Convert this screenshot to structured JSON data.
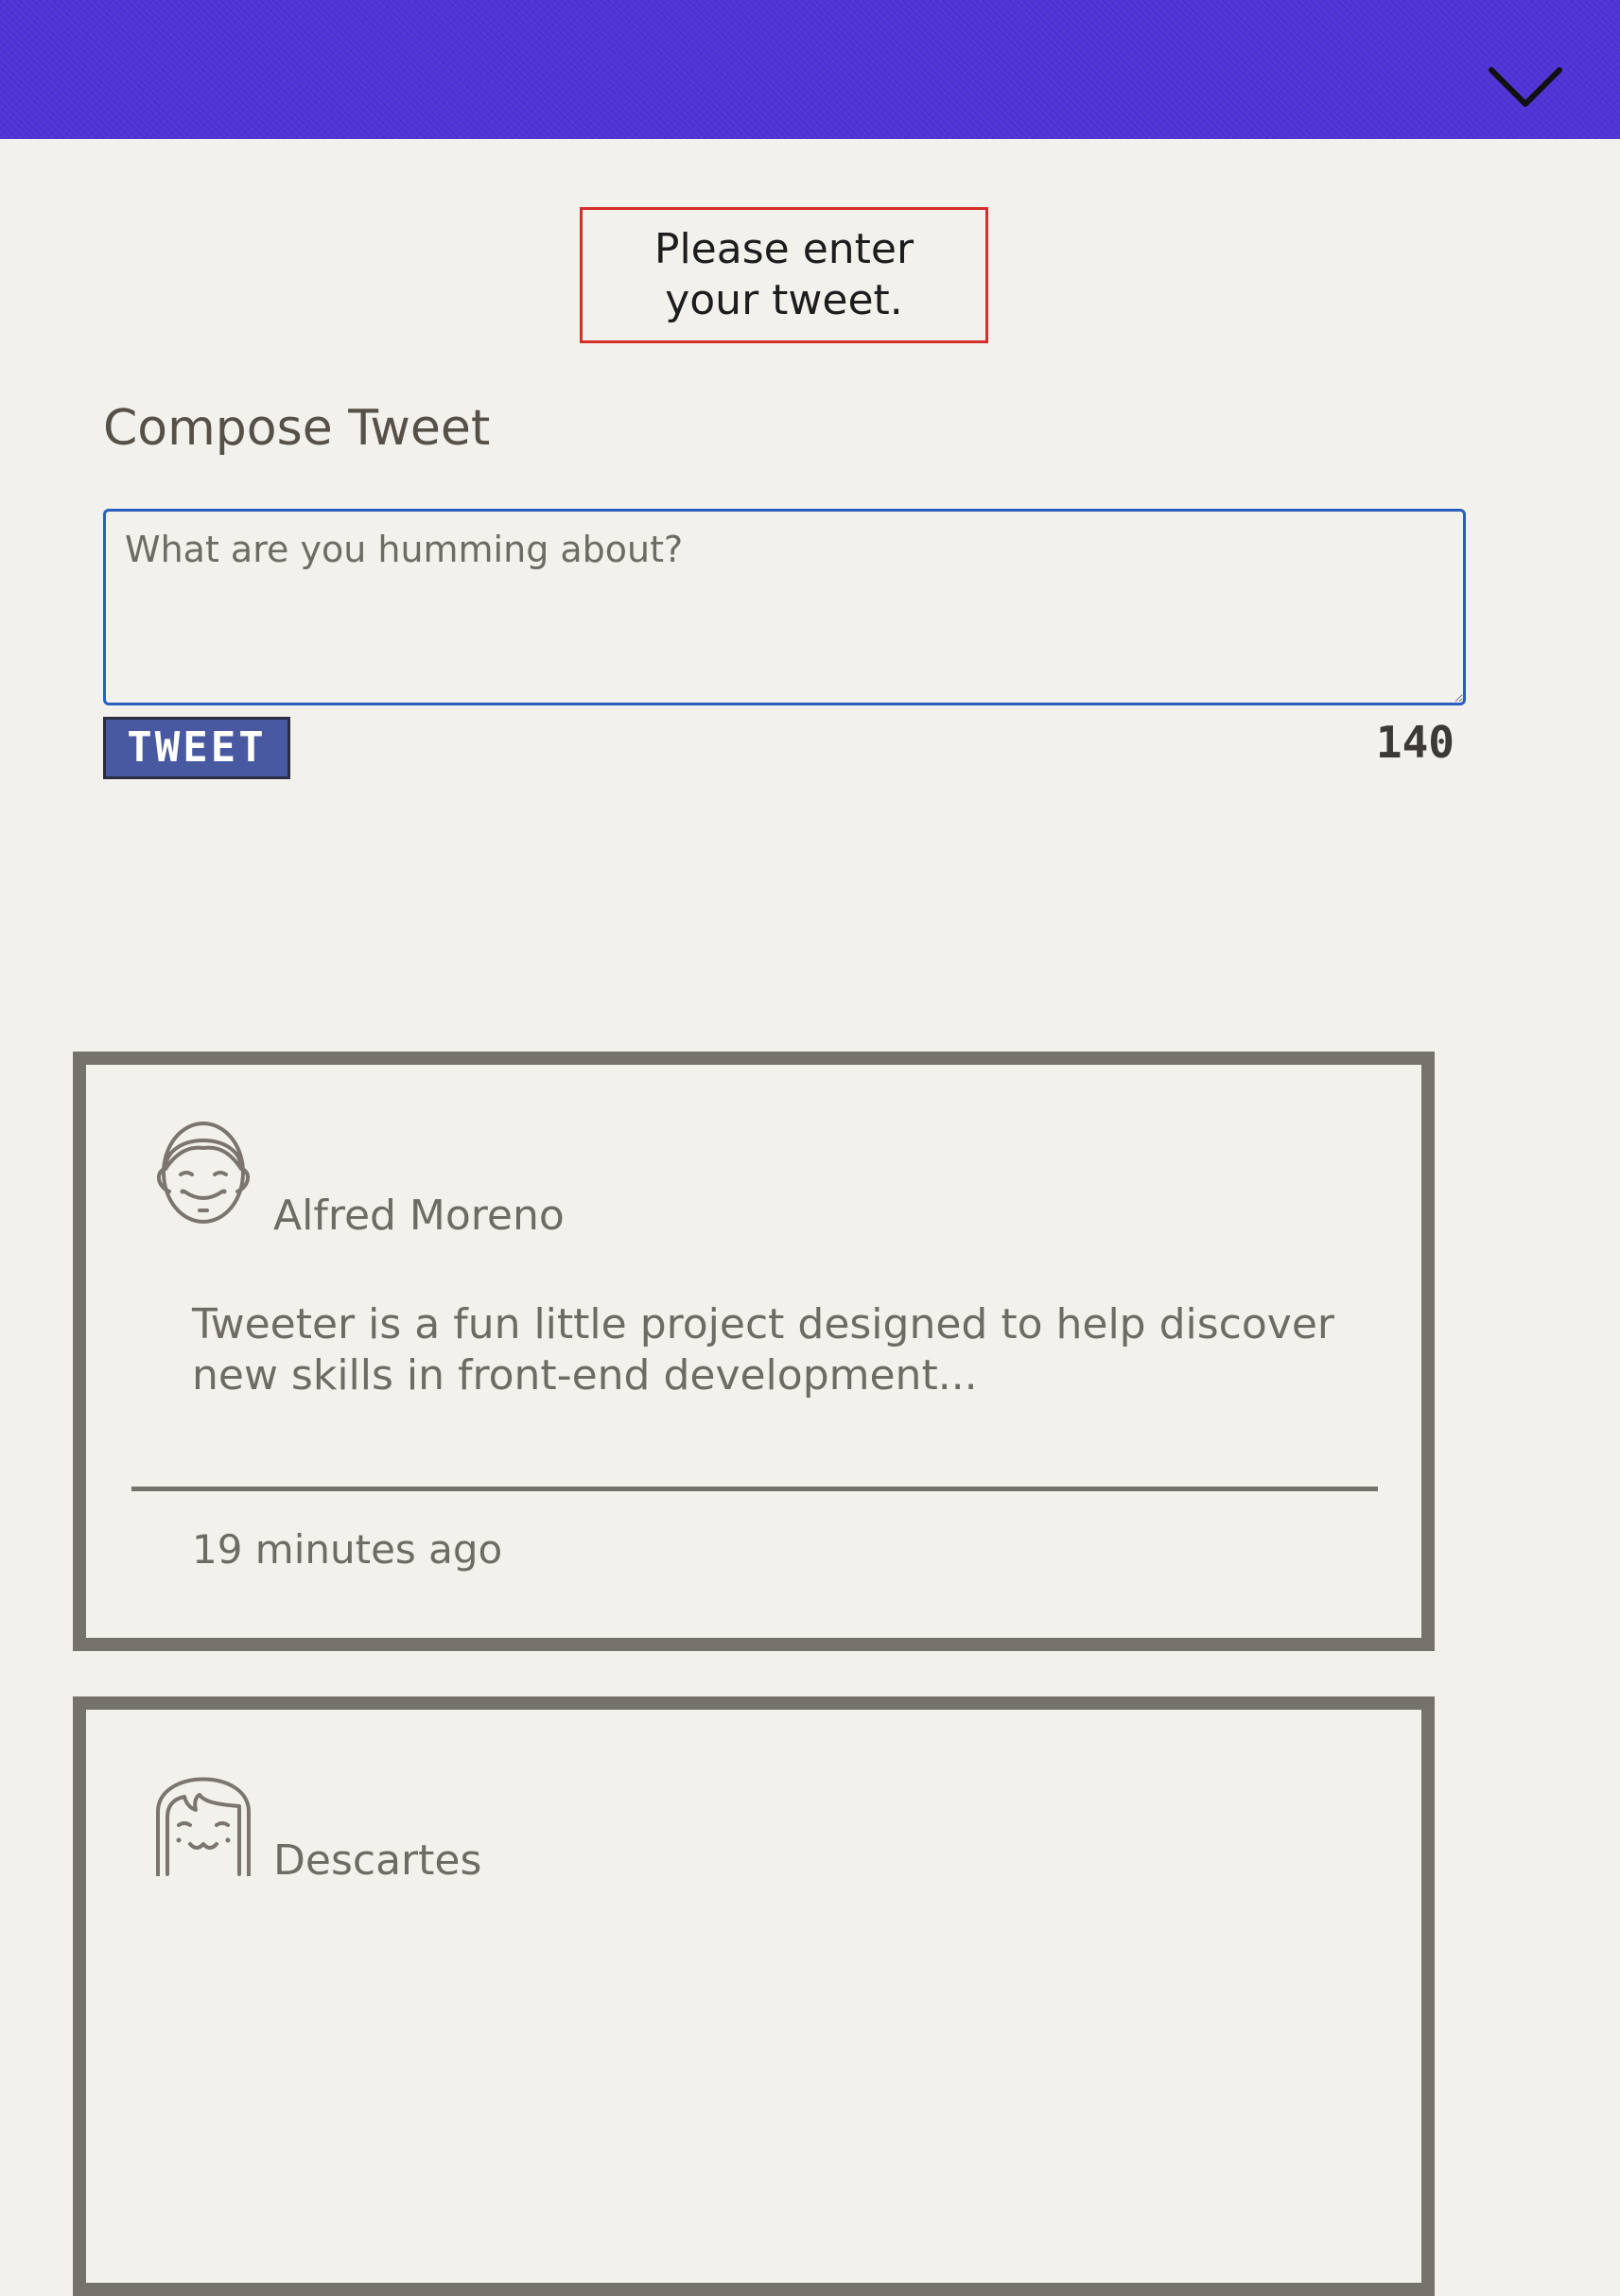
{
  "header": {
    "toggle_icon": "chevron-down-icon",
    "background_color": "#5033d6"
  },
  "error": {
    "message": "Please enter your tweet.",
    "border_color": "#d4302b"
  },
  "compose": {
    "title": "Compose Tweet",
    "placeholder": "What are you humming about?",
    "value": "",
    "button_label": "TWEET",
    "counter": "140"
  },
  "tweets": [
    {
      "avatar_icon": "male-face-avatar-icon",
      "author": "Alfred Moreno",
      "text": "Tweeter is a fun little project designed to help discover new skills in front-end development...",
      "time": "19 minutes ago"
    },
    {
      "avatar_icon": "female-face-avatar-icon",
      "author": "Descartes"
    }
  ],
  "colors": {
    "page_background": "#f3f1ec",
    "button": "#4959a1",
    "card_border": "#75716b",
    "input_focus_border": "#2a5fc0"
  }
}
